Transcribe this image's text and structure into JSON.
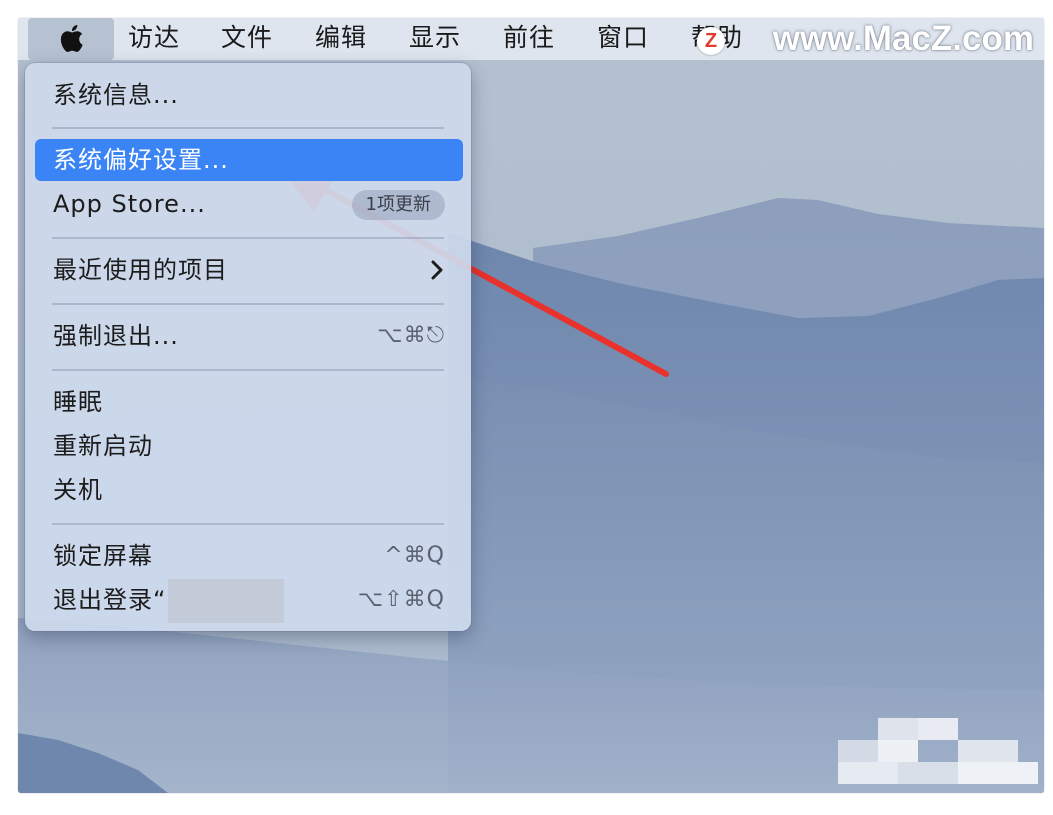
{
  "menubar": {
    "items": [
      "访达",
      "文件",
      "编辑",
      "显示",
      "前往",
      "窗口",
      "帮助"
    ]
  },
  "watermark": {
    "text": "www.MacZ.com",
    "logo_letter": "Z"
  },
  "apple_menu": {
    "items": [
      {
        "label": "系统信息..."
      },
      {
        "label": "系统偏好设置...",
        "selected": true
      },
      {
        "label": "App Store...",
        "badge": "1项更新"
      },
      {
        "label": "最近使用的项目",
        "submenu": true
      },
      {
        "label": "强制退出...",
        "shortcut": "⌥⌘⎋"
      },
      {
        "label": "睡眠"
      },
      {
        "label": "重新启动"
      },
      {
        "label": "关机"
      },
      {
        "label": "锁定屏幕",
        "shortcut": "^⌘Q"
      },
      {
        "label": "退出登录“",
        "shortcut": "⌥⇧⌘Q"
      }
    ]
  },
  "colors": {
    "selection": "#3a84f5",
    "annotation_arrow": "#e8322b"
  },
  "icons": {
    "apple": "apple-logo-icon",
    "submenu": "chevron-right-icon",
    "annotation": "red-arrow-icon"
  }
}
